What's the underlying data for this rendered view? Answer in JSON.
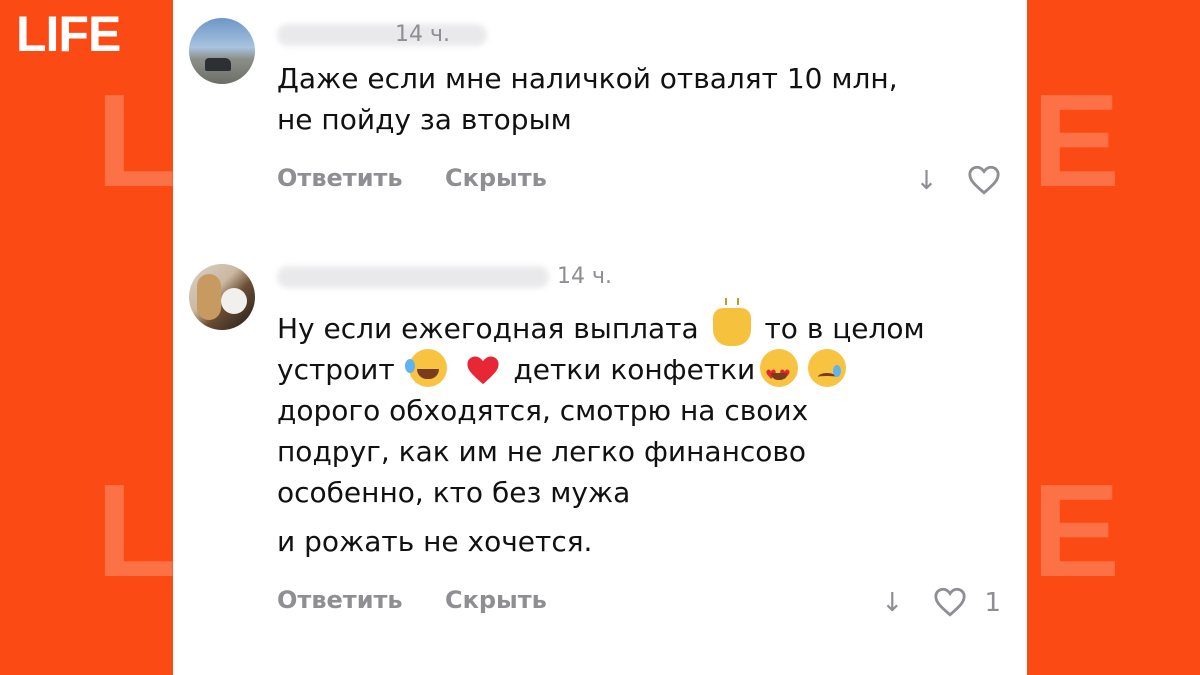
{
  "branding": {
    "logo": "LIFE",
    "watermark_left": "L",
    "watermark_right": "E"
  },
  "comments": [
    {
      "time": "14 ч.",
      "text_lines": [
        "Даже если мне наличкой отвалят 10 млн,",
        "не пойду за вторым"
      ],
      "reply_label": "Ответить",
      "hide_label": "Скрыть",
      "likes": ""
    },
    {
      "time": "14 ч.",
      "line1_a": "Ну если ежегодная выплата",
      "line1_b": "то в целом",
      "line2_a": "устроит",
      "line2_b": "детки конфетки",
      "text_lines": [
        "дорого обходятся,  смотрю на своих",
        "подруг, как им не легко финансово",
        "особенно, кто без мужа"
      ],
      "last_line": "и рожать не хочется.",
      "reply_label": "Ответить",
      "hide_label": "Скрыть",
      "likes": "1"
    }
  ],
  "icons": {
    "emoji": [
      "raising-hands",
      "tears-of-joy",
      "red-heart",
      "heart-eyes",
      "crying-face"
    ],
    "actions": [
      "down-arrow-icon",
      "heart-icon"
    ]
  },
  "colors": {
    "brand": "#fb4a13",
    "text": "#111111",
    "muted": "#8e8e93"
  }
}
